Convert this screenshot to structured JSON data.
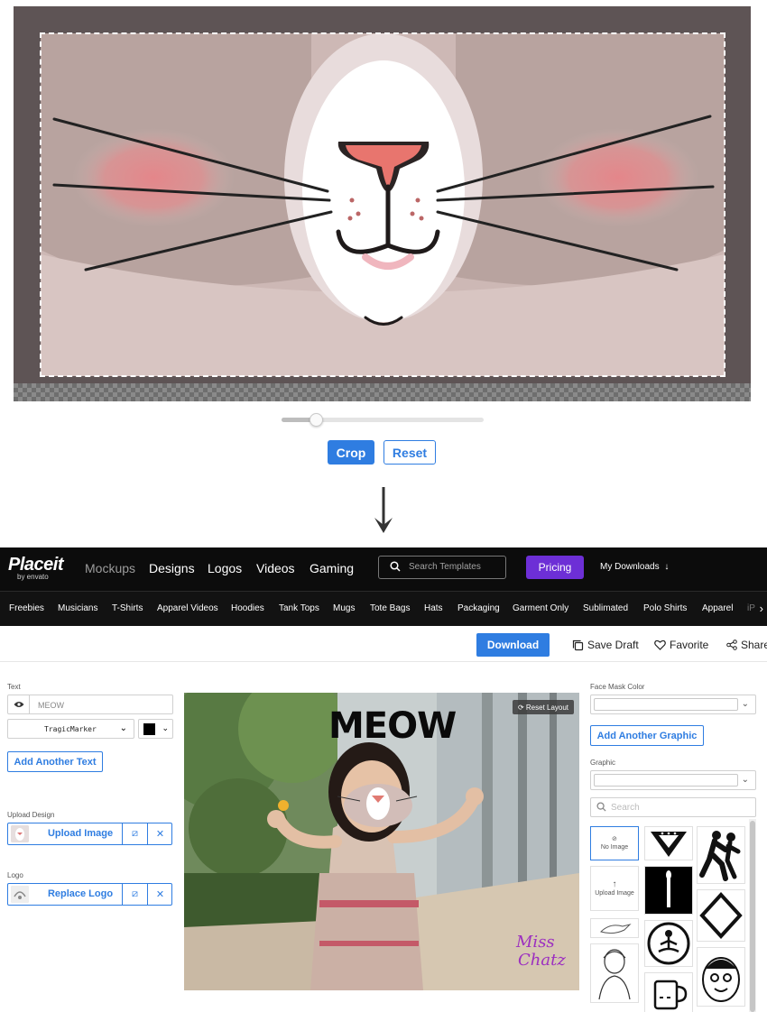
{
  "crop_editor": {
    "crop_label": "Crop",
    "reset_label": "Reset",
    "zoom_level": 0.17
  },
  "nav": {
    "logo": "Placeit",
    "logo_sub": "by envato",
    "links": [
      "Mockups",
      "Designs",
      "Logos",
      "Videos",
      "Gaming"
    ],
    "search_placeholder": "Search Templates",
    "pricing": "Pricing",
    "my_downloads": "My Downloads"
  },
  "subnav": {
    "items": [
      "Freebies",
      "Musicians",
      "T-Shirts",
      "Apparel Videos",
      "Hoodies",
      "Tank Tops",
      "Mugs",
      "Tote Bags",
      "Hats",
      "Packaging",
      "Garment Only",
      "Sublimated",
      "Polo Shirts",
      "Apparel",
      "iP"
    ]
  },
  "actions": {
    "download": "Download",
    "save_draft": "Save Draft",
    "favorite": "Favorite",
    "share": "Share"
  },
  "left_panel": {
    "text_label": "Text",
    "text_value": "MEOW",
    "font_value": "TragicMarker",
    "text_color": "#000000",
    "add_text": "Add Another Text",
    "upload_design_label": "Upload Design",
    "upload_image": "Upload Image",
    "logo_label": "Logo",
    "replace_logo": "Replace Logo"
  },
  "preview": {
    "reset_layout": "Reset Layout",
    "overlay_text": "MEOW",
    "signature": "Miss Chatz"
  },
  "right_panel": {
    "face_mask_color_label": "Face Mask Color",
    "add_graphic": "Add Another Graphic",
    "graphic_label": "Graphic",
    "search_placeholder": "Search",
    "no_image": "No Image",
    "upload_image_tile": "Upload Image"
  },
  "colors": {
    "accent": "#2f7de1",
    "pricing": "#6d2fd6",
    "nav_bg": "#0c0c0c"
  }
}
